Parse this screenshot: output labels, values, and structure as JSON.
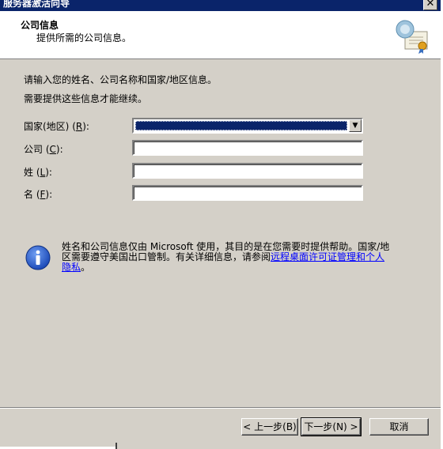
{
  "window": {
    "title": "服务器激活向导",
    "close_glyph": "✕"
  },
  "header": {
    "title": "公司信息",
    "subtitle": "提供所需的公司信息。",
    "icon": "certificate-icon"
  },
  "intro": {
    "line1": "请输入您的姓名、公司名称和国家/地区信息。",
    "line2": "需要提供这些信息才能继续。"
  },
  "form": {
    "country_label": "国家(地区)",
    "country_key": "R",
    "company_label": "公司",
    "company_key": "C",
    "lastname_label": "姓",
    "lastname_key": "L",
    "firstname_label": "名",
    "firstname_key": "F",
    "country_value": "",
    "company_value": "",
    "lastname_value": "",
    "firstname_value": ""
  },
  "info": {
    "icon": "info-icon",
    "text": "姓名和公司信息仅由 Microsoft 使用，其目的是在您需要时提供帮助。国家/地区需要遵守美国出口管制。有关详细信息，请参阅",
    "link": "远程桌面许可证管理和个人隐私",
    "tail": "。"
  },
  "buttons": {
    "back": "< 上一步(B)",
    "next": "下一步(N) >",
    "cancel": "取消"
  }
}
